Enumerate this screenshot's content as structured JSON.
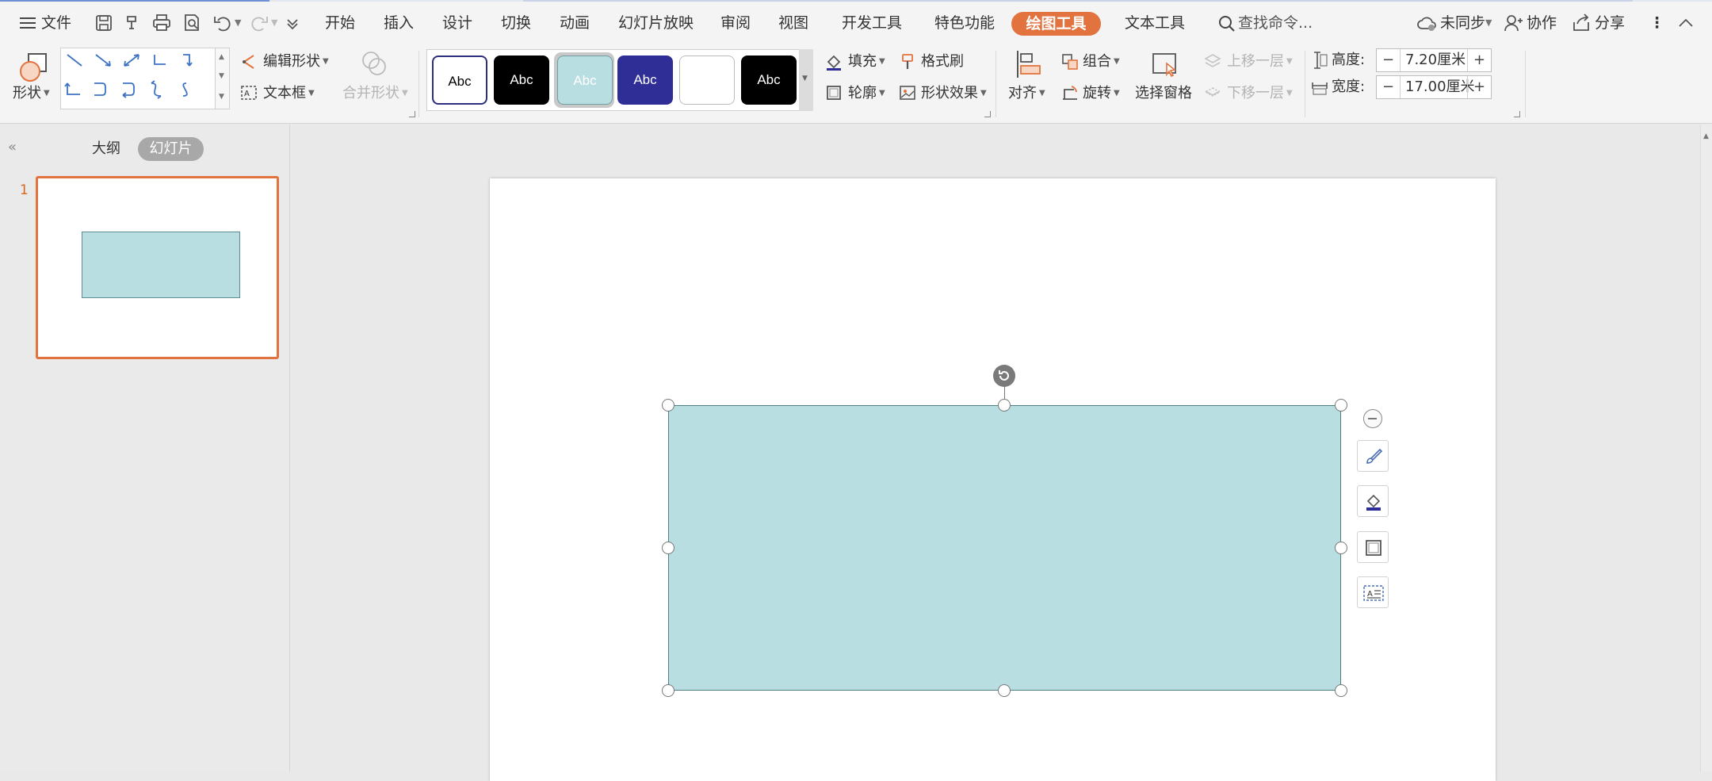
{
  "menu": {
    "file": "文件",
    "tabs": [
      "开始",
      "插入",
      "设计",
      "切换",
      "动画",
      "幻灯片放映",
      "审阅",
      "视图",
      "开发工具",
      "特色功能"
    ],
    "active_tab": "绘图工具",
    "text_tools": "文本工具",
    "search_placeholder": "查找命令...",
    "sync": "未同步",
    "collab": "协作",
    "share": "分享"
  },
  "ribbon": {
    "shapes": "形状",
    "edit_shape": "编辑形状",
    "text_box": "文本框",
    "merge_shapes": "合并形状",
    "style_samples": [
      "Abc",
      "Abc",
      "Abc",
      "Abc",
      "",
      "Abc"
    ],
    "style_colors": {
      "outline_white": "#ffffff",
      "black": "#000000",
      "light_teal": "#b8dee2",
      "navy": "#2e2e96",
      "plain_white": "#ffffff",
      "black2": "#000000"
    },
    "fill": "填充",
    "format_painter": "格式刷",
    "outline": "轮廓",
    "shape_effects": "形状效果",
    "align": "对齐",
    "group": "组合",
    "rotate": "旋转",
    "selection_pane": "选择窗格",
    "bring_forward": "上移一层",
    "send_backward": "下移一层",
    "height_label": "高度:",
    "height_value": "7.20厘米",
    "width_label": "宽度:",
    "width_value": "17.00厘米"
  },
  "left_pane": {
    "tab_outline": "大纲",
    "tab_slides": "幻灯片",
    "slide_number": "1"
  },
  "slide": {
    "shape_fill": "#b8dee2",
    "shape_border": "#4d7f84"
  },
  "colors": {
    "accent": "#e2733f",
    "menu_bg": "#f4f4f4"
  },
  "icons": [
    "menu-icon",
    "save-icon",
    "format-copy-icon",
    "print-icon",
    "print-preview-icon",
    "undo-icon",
    "redo-icon",
    "customize-icon",
    "search-icon",
    "cloud-icon",
    "collab-icon",
    "share-icon",
    "more-icon",
    "collapse-ribbon-icon"
  ]
}
